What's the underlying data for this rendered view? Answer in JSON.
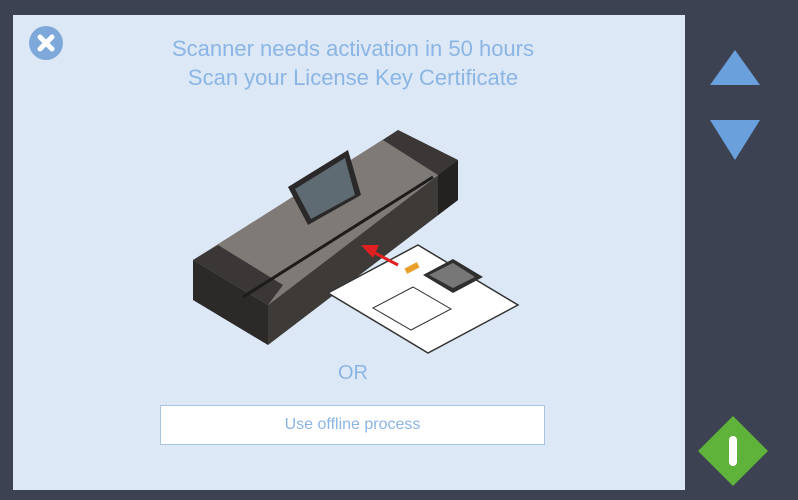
{
  "title": {
    "line1": "Scanner needs activation in 50 hours",
    "line2": "Scan your License Key Certificate"
  },
  "or_label": "OR",
  "offline_button": {
    "label": "Use offline process"
  },
  "icons": {
    "close": "close-icon",
    "scroll_up": "triangle-up-icon",
    "scroll_down": "triangle-down-icon",
    "power": "power-icon"
  },
  "colors": {
    "panel_bg": "#dde8f6",
    "text_accent": "#8bb5e4",
    "side_bg": "#3d4252",
    "arrow": "#6aa0dc",
    "power": "#5fb23a",
    "scan_arrow": "#e02020"
  }
}
